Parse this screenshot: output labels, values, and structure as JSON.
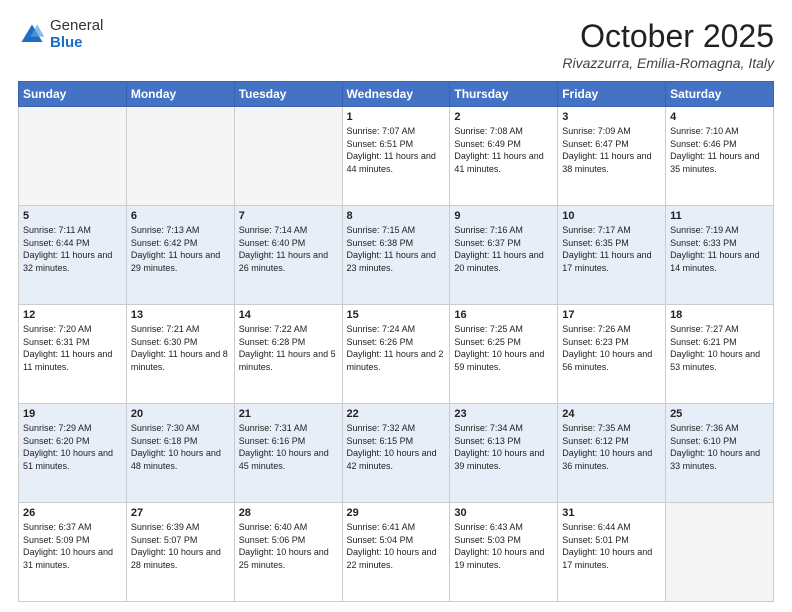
{
  "header": {
    "logo_general": "General",
    "logo_blue": "Blue",
    "title": "October 2025",
    "subtitle": "Rivazzurra, Emilia-Romagna, Italy"
  },
  "days_of_week": [
    "Sunday",
    "Monday",
    "Tuesday",
    "Wednesday",
    "Thursday",
    "Friday",
    "Saturday"
  ],
  "weeks": [
    [
      {
        "day": "",
        "info": ""
      },
      {
        "day": "",
        "info": ""
      },
      {
        "day": "",
        "info": ""
      },
      {
        "day": "1",
        "info": "Sunrise: 7:07 AM\nSunset: 6:51 PM\nDaylight: 11 hours and 44 minutes."
      },
      {
        "day": "2",
        "info": "Sunrise: 7:08 AM\nSunset: 6:49 PM\nDaylight: 11 hours and 41 minutes."
      },
      {
        "day": "3",
        "info": "Sunrise: 7:09 AM\nSunset: 6:47 PM\nDaylight: 11 hours and 38 minutes."
      },
      {
        "day": "4",
        "info": "Sunrise: 7:10 AM\nSunset: 6:46 PM\nDaylight: 11 hours and 35 minutes."
      }
    ],
    [
      {
        "day": "5",
        "info": "Sunrise: 7:11 AM\nSunset: 6:44 PM\nDaylight: 11 hours and 32 minutes."
      },
      {
        "day": "6",
        "info": "Sunrise: 7:13 AM\nSunset: 6:42 PM\nDaylight: 11 hours and 29 minutes."
      },
      {
        "day": "7",
        "info": "Sunrise: 7:14 AM\nSunset: 6:40 PM\nDaylight: 11 hours and 26 minutes."
      },
      {
        "day": "8",
        "info": "Sunrise: 7:15 AM\nSunset: 6:38 PM\nDaylight: 11 hours and 23 minutes."
      },
      {
        "day": "9",
        "info": "Sunrise: 7:16 AM\nSunset: 6:37 PM\nDaylight: 11 hours and 20 minutes."
      },
      {
        "day": "10",
        "info": "Sunrise: 7:17 AM\nSunset: 6:35 PM\nDaylight: 11 hours and 17 minutes."
      },
      {
        "day": "11",
        "info": "Sunrise: 7:19 AM\nSunset: 6:33 PM\nDaylight: 11 hours and 14 minutes."
      }
    ],
    [
      {
        "day": "12",
        "info": "Sunrise: 7:20 AM\nSunset: 6:31 PM\nDaylight: 11 hours and 11 minutes."
      },
      {
        "day": "13",
        "info": "Sunrise: 7:21 AM\nSunset: 6:30 PM\nDaylight: 11 hours and 8 minutes."
      },
      {
        "day": "14",
        "info": "Sunrise: 7:22 AM\nSunset: 6:28 PM\nDaylight: 11 hours and 5 minutes."
      },
      {
        "day": "15",
        "info": "Sunrise: 7:24 AM\nSunset: 6:26 PM\nDaylight: 11 hours and 2 minutes."
      },
      {
        "day": "16",
        "info": "Sunrise: 7:25 AM\nSunset: 6:25 PM\nDaylight: 10 hours and 59 minutes."
      },
      {
        "day": "17",
        "info": "Sunrise: 7:26 AM\nSunset: 6:23 PM\nDaylight: 10 hours and 56 minutes."
      },
      {
        "day": "18",
        "info": "Sunrise: 7:27 AM\nSunset: 6:21 PM\nDaylight: 10 hours and 53 minutes."
      }
    ],
    [
      {
        "day": "19",
        "info": "Sunrise: 7:29 AM\nSunset: 6:20 PM\nDaylight: 10 hours and 51 minutes."
      },
      {
        "day": "20",
        "info": "Sunrise: 7:30 AM\nSunset: 6:18 PM\nDaylight: 10 hours and 48 minutes."
      },
      {
        "day": "21",
        "info": "Sunrise: 7:31 AM\nSunset: 6:16 PM\nDaylight: 10 hours and 45 minutes."
      },
      {
        "day": "22",
        "info": "Sunrise: 7:32 AM\nSunset: 6:15 PM\nDaylight: 10 hours and 42 minutes."
      },
      {
        "day": "23",
        "info": "Sunrise: 7:34 AM\nSunset: 6:13 PM\nDaylight: 10 hours and 39 minutes."
      },
      {
        "day": "24",
        "info": "Sunrise: 7:35 AM\nSunset: 6:12 PM\nDaylight: 10 hours and 36 minutes."
      },
      {
        "day": "25",
        "info": "Sunrise: 7:36 AM\nSunset: 6:10 PM\nDaylight: 10 hours and 33 minutes."
      }
    ],
    [
      {
        "day": "26",
        "info": "Sunrise: 6:37 AM\nSunset: 5:09 PM\nDaylight: 10 hours and 31 minutes."
      },
      {
        "day": "27",
        "info": "Sunrise: 6:39 AM\nSunset: 5:07 PM\nDaylight: 10 hours and 28 minutes."
      },
      {
        "day": "28",
        "info": "Sunrise: 6:40 AM\nSunset: 5:06 PM\nDaylight: 10 hours and 25 minutes."
      },
      {
        "day": "29",
        "info": "Sunrise: 6:41 AM\nSunset: 5:04 PM\nDaylight: 10 hours and 22 minutes."
      },
      {
        "day": "30",
        "info": "Sunrise: 6:43 AM\nSunset: 5:03 PM\nDaylight: 10 hours and 19 minutes."
      },
      {
        "day": "31",
        "info": "Sunrise: 6:44 AM\nSunset: 5:01 PM\nDaylight: 10 hours and 17 minutes."
      },
      {
        "day": "",
        "info": ""
      }
    ]
  ]
}
